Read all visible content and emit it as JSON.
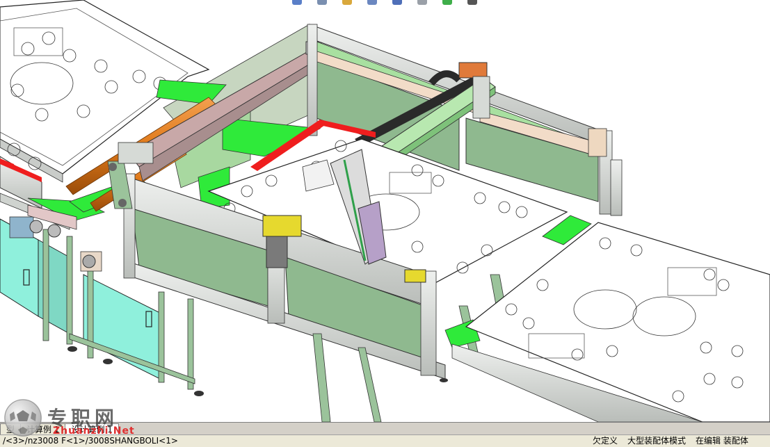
{
  "app": {
    "tabs": [
      "型",
      "计算例 1",
      "设计算例 1"
    ],
    "status": {
      "path": "/<3>/nz3008 F<1>/3008SHANGBOLI<1>",
      "mode_left": "欠定义",
      "mode_mid": "大型装配体模式",
      "mode_right": "在编辑 装配体"
    }
  },
  "watermark": {
    "brand_cn": "专职网",
    "brand_en": "Zhuanzhi.Net"
  },
  "colors": {
    "frame_green": "#9bc39b",
    "panel_green": "#8fb98f",
    "belt_bright_green": "#2fea3a",
    "rail_red": "#ef1e1e",
    "aluminum": "#d6dad6",
    "cyan_panel": "#8ff0dc",
    "roller_orange": "#e07a1a",
    "board_pink": "#c8a8a8",
    "cable_chain": "#2a2a2a",
    "bracket_yellow": "#e6d92e",
    "slider_purple": "#b6a0c8"
  },
  "icons": [
    "toolbar-icon-1",
    "toolbar-icon-2",
    "toolbar-icon-3",
    "toolbar-icon-4",
    "toolbar-icon-5",
    "toolbar-icon-6",
    "toolbar-icon-7",
    "toolbar-icon-8"
  ]
}
